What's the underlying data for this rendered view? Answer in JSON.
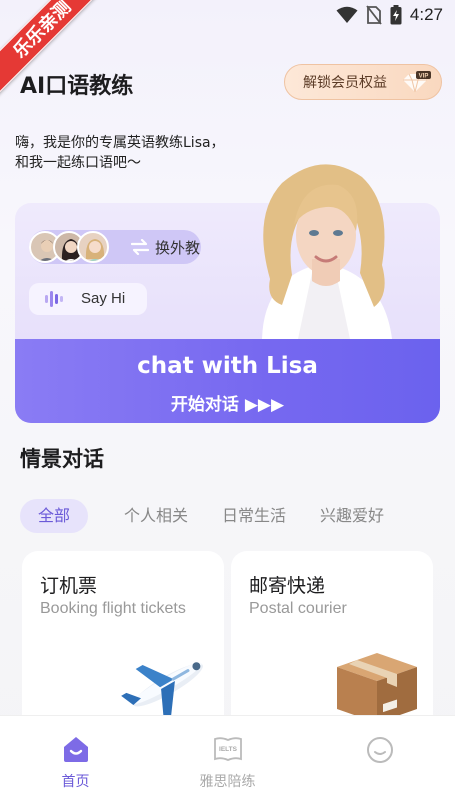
{
  "status_bar": {
    "time": "4:27"
  },
  "watermark": {
    "text": "乐乐亲测"
  },
  "header": {
    "title": "AI口语教练",
    "vip_button_label": "解锁会员权益",
    "vip_badge": "VIP"
  },
  "intro": {
    "line1": "嗨，我是你的专属英语教练Lisa，",
    "line2": "和我一起练口语吧～"
  },
  "coach_card": {
    "switch_label": "换外教",
    "say_hi": "Say Hi",
    "chat_title": "chat with Lisa",
    "start_label": "开始对话 ▶▶▶"
  },
  "scenario": {
    "title": "情景对话",
    "tabs": [
      "全部",
      "个人相关",
      "日常生活",
      "兴趣爱好"
    ],
    "cards": [
      {
        "title": "订机票",
        "subtitle": "Booking flight tickets",
        "icon": "airplane-icon"
      },
      {
        "title": "邮寄快递",
        "subtitle": "Postal courier",
        "icon": "package-icon"
      }
    ]
  },
  "bottom_nav": {
    "items": [
      {
        "label": "首页",
        "icon": "home-icon",
        "active": true
      },
      {
        "label": "雅思陪练",
        "icon": "ielts-book-icon",
        "active": false
      },
      {
        "label": "",
        "icon": "profile-face-icon",
        "active": false
      }
    ],
    "ielts_icon_text": "IELTS"
  },
  "colors": {
    "accent": "#6b5ad8",
    "card_gradient_start": "#8a7cf4",
    "card_gradient_end": "#6b62ee",
    "vip_bg": "#f9d8bf",
    "watermark_red": "#e53935"
  }
}
